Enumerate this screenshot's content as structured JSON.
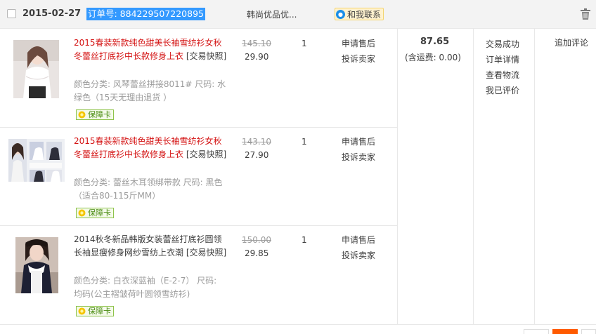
{
  "order": {
    "date": "2015-02-27",
    "order_no_label": "订单号: 884229507220895",
    "shop": "韩尚优品优...",
    "contact_label": "和我联系",
    "total": "87.65",
    "shipping": "(含运费: 0.00)",
    "status_links": [
      "交易成功",
      "订单详情",
      "查看物流",
      "我已评价"
    ],
    "review_link": "追加评论"
  },
  "items": [
    {
      "title_red": "2015春装新款纯色甜美长袖雪纺衫女秋冬蕾丝打底衫中长款修身上衣",
      "snapshot": "[交易快照]",
      "attrs": "颜色分类: 风琴蕾丝拼接8011# 尺码: 水绿色（15天无理由退货 ）",
      "badge": "保障卡",
      "price_old": "145.10",
      "price": "29.90",
      "qty": "1",
      "actions": [
        "申请售后",
        "投诉卖家"
      ]
    },
    {
      "title_red": "2015春装新款纯色甜美长袖雪纺衫女秋冬蕾丝打底衫中长款修身上衣",
      "snapshot": "[交易快照]",
      "attrs": "颜色分类: 蕾丝木耳领绑带款 尺码: 黑色（适合80-115斤MM）",
      "badge": "保障卡",
      "price_old": "143.10",
      "price": "27.90",
      "qty": "1",
      "actions": [
        "申请售后",
        "投诉卖家"
      ]
    },
    {
      "title_dark": "2014秋冬新品韩版女装蕾丝打底衫圆领长袖显瘦修身网纱雪纺上衣潮",
      "snapshot": "[交易快照]",
      "attrs": "颜色分类: 白衣深蓝袖（E-2-7） 尺码: 均码(公主褶皱荷叶圆领雪纺衫)",
      "badge": "保障卡",
      "price_old": "150.00",
      "price": "29.85",
      "qty": "1",
      "actions": [
        "申请售后",
        "投诉卖家"
      ]
    }
  ],
  "colors": {
    "accent_red": "#d41212",
    "highlight_blue": "#3399ff",
    "badge_green": "#8ec34a",
    "pager_orange": "#ff5a00"
  },
  "icons": {
    "trash": "trash-icon",
    "wangwang": "wangwang-icon",
    "badge": "leaf-icon"
  }
}
